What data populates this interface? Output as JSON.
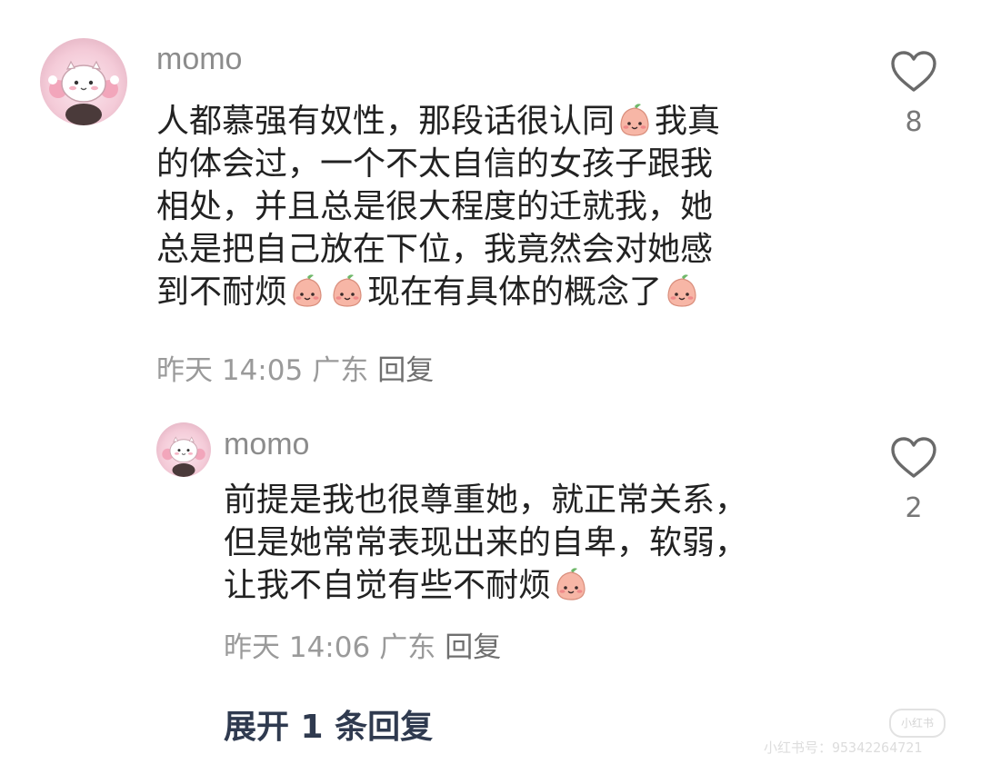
{
  "comments": [
    {
      "username": "momo",
      "lines": [
        [
          "人都慕强有奴性，那段话很认同",
          "[peach-emoji]",
          "我真"
        ],
        [
          "的体会过，一个不太自信的女孩子跟我"
        ],
        [
          "相处，并且总是很大程度的迁就我，她"
        ],
        [
          "总是把自己放在下位，我竟然会对她感"
        ],
        [
          "到不耐烦",
          "[peach-emoji]",
          "[peach-emoji]",
          "现在有具体的概念了",
          "[peach-emoji]"
        ]
      ],
      "time": "昨天 14:05",
      "location": "广东",
      "reply_label": "回复",
      "likes": "8"
    },
    {
      "username": "momo",
      "lines": [
        [
          "前提是我也很尊重她，就正常关系，"
        ],
        [
          "但是她常常表现出来的自卑，软弱，"
        ],
        [
          "让我不自觉有些不耐烦",
          "[peach-emoji]"
        ]
      ],
      "time": "昨天 14:06",
      "location": "广东",
      "reply_label": "回复",
      "likes": "2"
    }
  ],
  "expand_label": "展开 1 条回复",
  "watermark": {
    "logo_text": "小红书",
    "id_text": "小红书号：95342264721"
  },
  "colors": {
    "text": "#222222",
    "meta": "#9a9a9a",
    "username": "#8c8c8c",
    "expand": "#2f3a4f",
    "avatar_pink": "#f4cbd8",
    "emoji_peach": "#f7b6a6"
  },
  "icons": {
    "like": "heart-outline-icon",
    "emoji": "peach-emoji"
  }
}
